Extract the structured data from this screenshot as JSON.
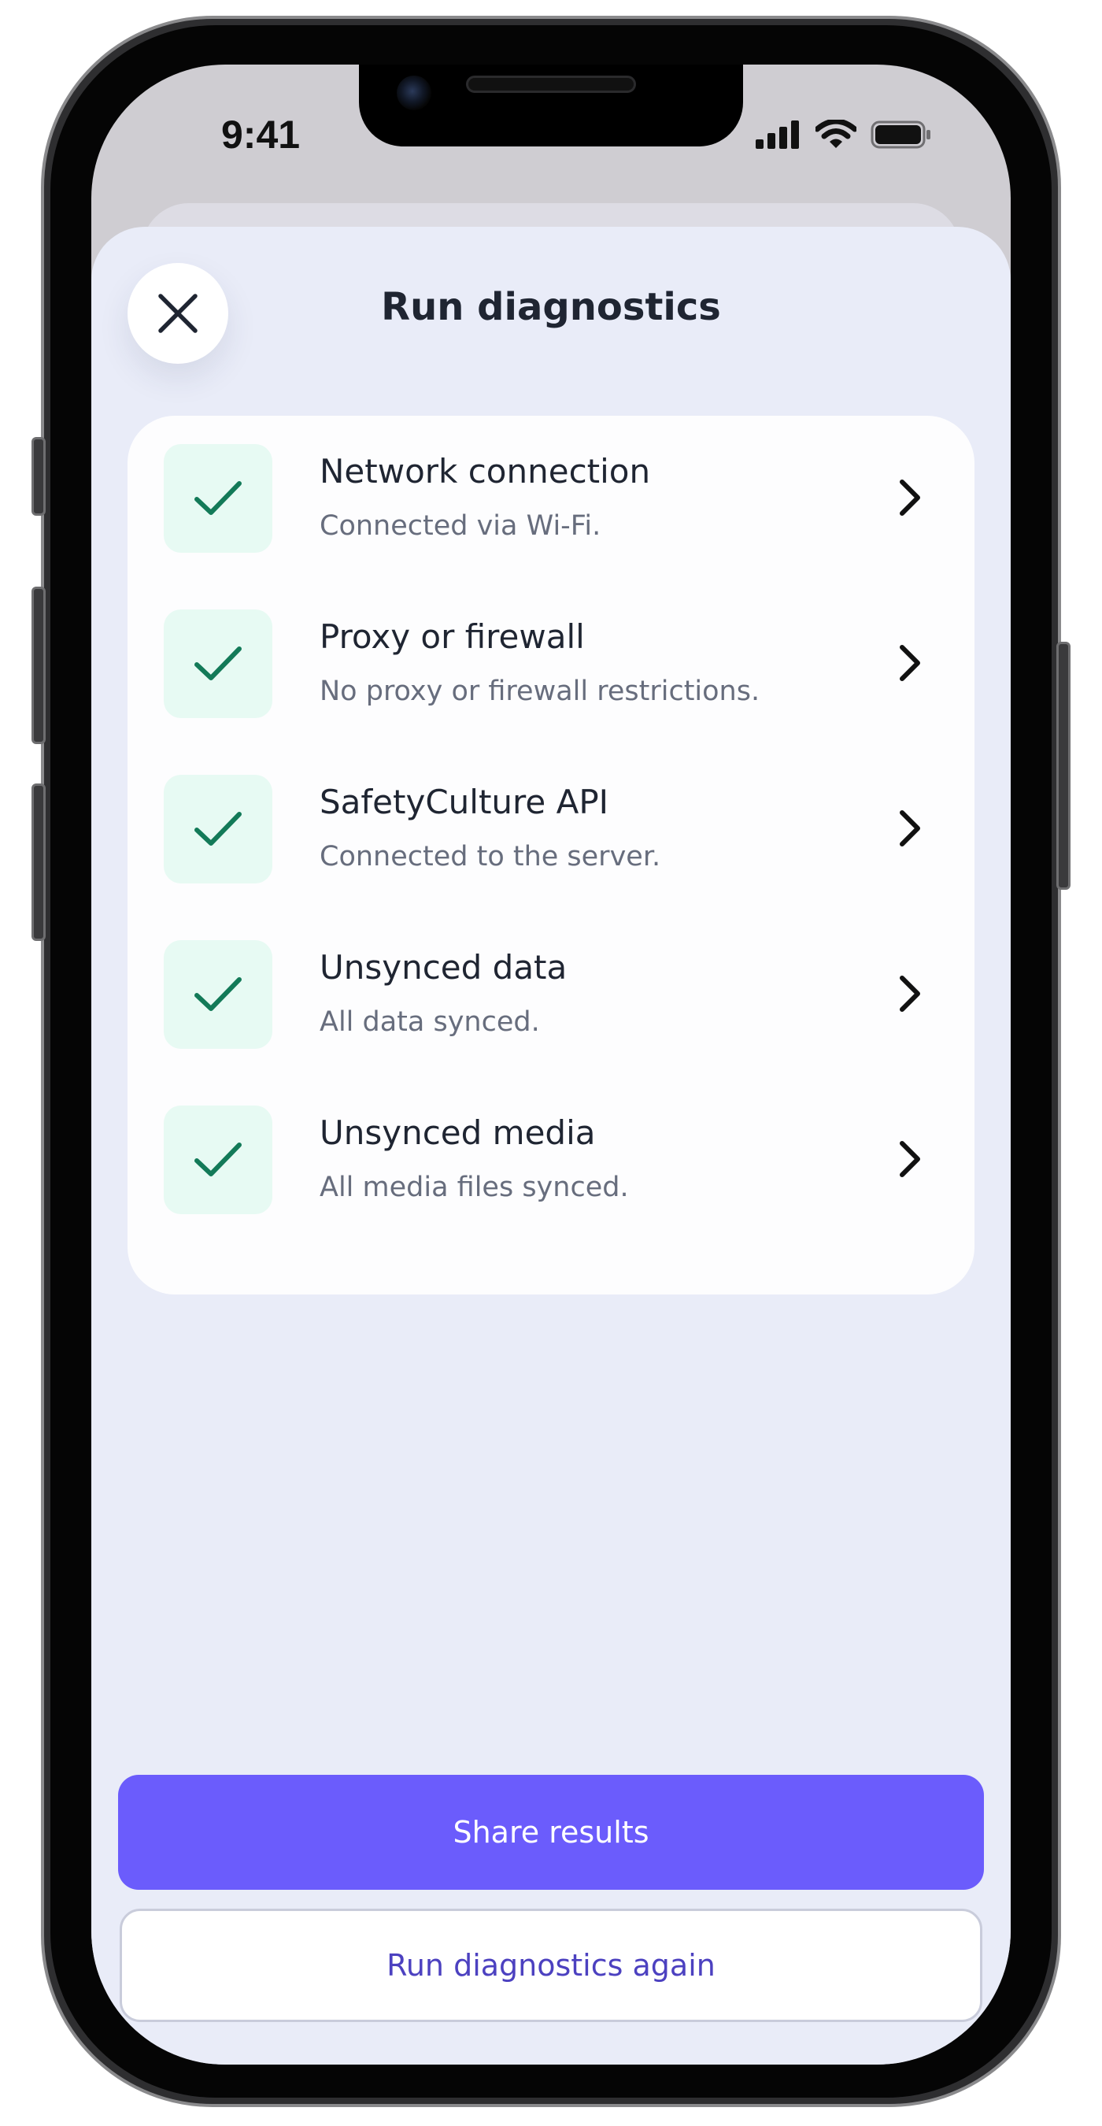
{
  "status_bar": {
    "time": "9:41"
  },
  "modal": {
    "title": "Run diagnostics",
    "close_icon": "close-icon"
  },
  "diagnostics": [
    {
      "title": "Network connection",
      "subtitle": "Connected via Wi-Fi.",
      "status": "passed"
    },
    {
      "title": "Proxy or firewall",
      "subtitle": "No proxy or firewall restrictions.",
      "status": "passed"
    },
    {
      "title": "SafetyCulture API",
      "subtitle": "Connected to the server.",
      "status": "passed"
    },
    {
      "title": "Unsynced data",
      "subtitle": "All data synced.",
      "status": "passed"
    },
    {
      "title": "Unsynced media",
      "subtitle": "All media files synced.",
      "status": "passed"
    }
  ],
  "actions": {
    "primary_label": "Share results",
    "secondary_label": "Run diagnostics again"
  },
  "colors": {
    "accent": "#6b5cfc",
    "accent_text": "#4c41c0",
    "success_icon": "#137a58",
    "success_tile": "#e7faf3",
    "sheet_background": "#e9ecf8"
  }
}
